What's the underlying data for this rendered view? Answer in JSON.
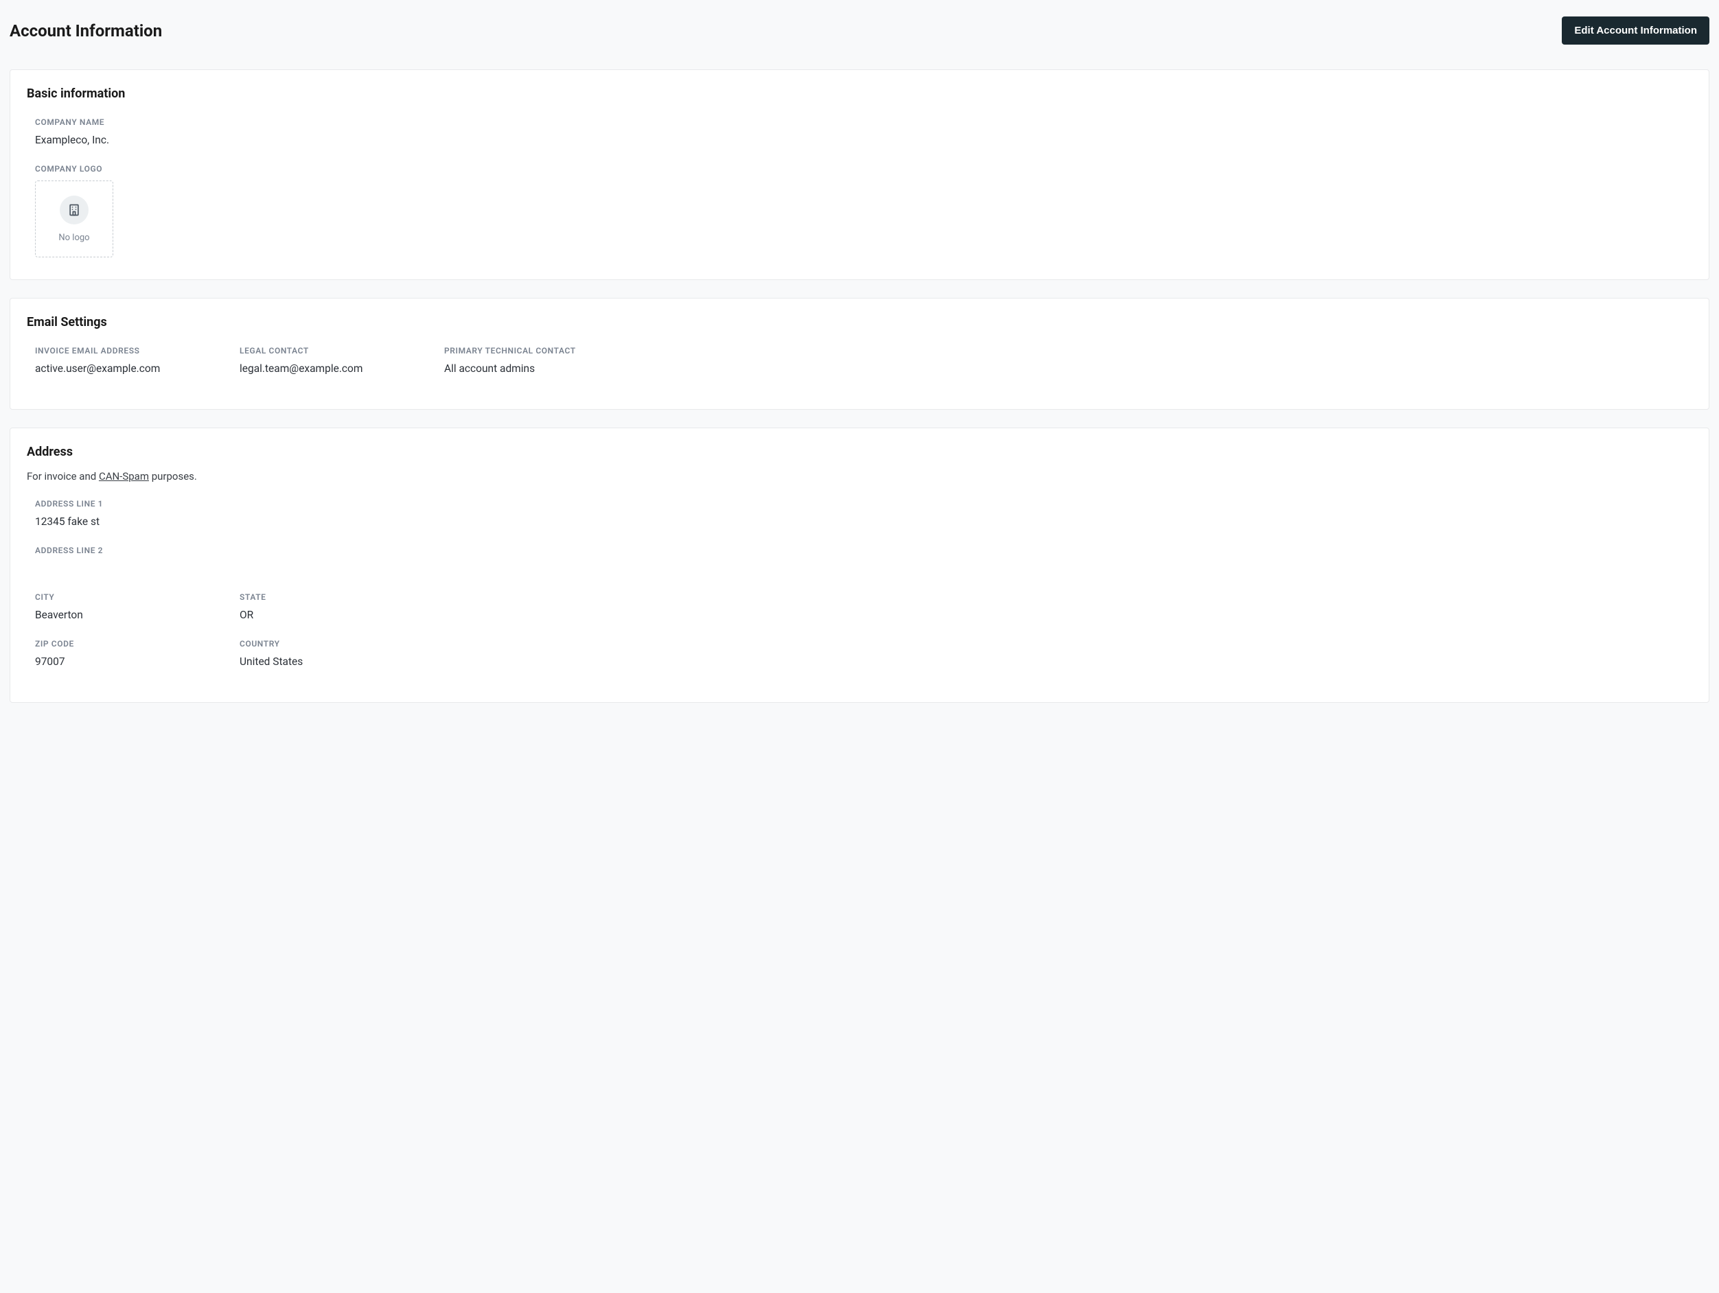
{
  "header": {
    "title": "Account Information",
    "edit_button": "Edit Account Information"
  },
  "basic_info": {
    "section_title": "Basic information",
    "company_name_label": "COMPANY NAME",
    "company_name_value": "Exampleco, Inc.",
    "company_logo_label": "COMPANY LOGO",
    "no_logo_text": "No logo"
  },
  "email_settings": {
    "section_title": "Email Settings",
    "invoice_email_label": "INVOICE EMAIL ADDRESS",
    "invoice_email_value": "active.user@example.com",
    "legal_contact_label": "LEGAL CONTACT",
    "legal_contact_value": "legal.team@example.com",
    "primary_tech_label": "PRIMARY TECHNICAL CONTACT",
    "primary_tech_value": "All account admins"
  },
  "address": {
    "section_title": "Address",
    "description_prefix": "For invoice and ",
    "can_spam_link": "CAN-Spam",
    "description_suffix": " purposes.",
    "line1_label": "ADDRESS LINE 1",
    "line1_value": "12345 fake st",
    "line2_label": "ADDRESS LINE 2",
    "line2_value": "",
    "city_label": "CITY",
    "city_value": "Beaverton",
    "state_label": "STATE",
    "state_value": "OR",
    "zip_label": "ZIP CODE",
    "zip_value": "97007",
    "country_label": "COUNTRY",
    "country_value": "United States"
  }
}
